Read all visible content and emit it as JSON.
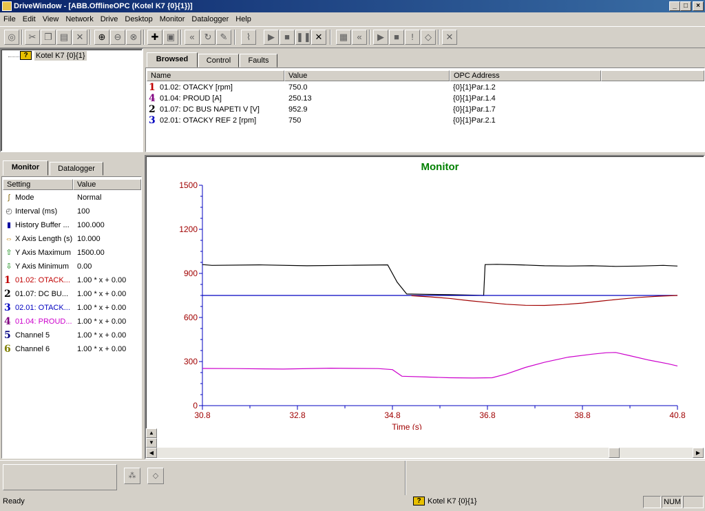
{
  "window": {
    "title": "DriveWindow - [ABB.OfflineOPC (Kotel K7 {0}{1})]",
    "min_label": "_",
    "max_label": "□",
    "close_label": "×"
  },
  "menu": [
    "File",
    "Edit",
    "View",
    "Network",
    "Drive",
    "Desktop",
    "Monitor",
    "Datalogger",
    "Help"
  ],
  "tree": {
    "root_label": "Kotel K7 {0}{1}"
  },
  "top_tabs": [
    "Browsed",
    "Control",
    "Faults"
  ],
  "browsed": {
    "columns": [
      "Name",
      "Value",
      "OPC Address"
    ],
    "rows": [
      {
        "num": "1",
        "color": "#c00000",
        "name": "01.02: OTACKY [rpm]",
        "value": "750.0",
        "opc": "{0}{1}Par.1.2"
      },
      {
        "num": "4",
        "color": "#800080",
        "name": "01.04: PROUD [A]",
        "value": "250.13",
        "opc": "{0}{1}Par.1.4"
      },
      {
        "num": "2",
        "color": "#000000",
        "name": "01.07: DC BUS NAPETI V [V]",
        "value": "952.9",
        "opc": "{0}{1}Par.1.7"
      },
      {
        "num": "3",
        "color": "#0000c0",
        "name": "02.01: OTACKY REF 2 [rpm]",
        "value": "750",
        "opc": "{0}{1}Par.2.1"
      }
    ]
  },
  "left_tabs": [
    "Monitor",
    "Datalogger"
  ],
  "settings": {
    "columns": [
      "Setting",
      "Value"
    ],
    "rows": [
      {
        "icon": "mode-icon",
        "label": "Mode",
        "value": "Normal",
        "color": "#000000"
      },
      {
        "icon": "clock-icon",
        "label": "Interval (ms)",
        "value": "100",
        "color": "#000000"
      },
      {
        "icon": "book-icon",
        "label": "History Buffer ...",
        "value": "100.000",
        "color": "#000000"
      },
      {
        "icon": "arrows-icon",
        "label": "X Axis Length (s)",
        "value": "10.000",
        "color": "#000000"
      },
      {
        "icon": "up-arrow-icon",
        "label": "Y Axis Maximum",
        "value": "1500.00",
        "color": "#000000"
      },
      {
        "icon": "down-arrow-icon",
        "label": "Y Axis Minimum",
        "value": "0.00",
        "color": "#000000"
      },
      {
        "num": "1",
        "numcolor": "#c00000",
        "label": "01.02: OTACK...",
        "value": "1.00 * x + 0.00",
        "color": "#c00000"
      },
      {
        "num": "2",
        "numcolor": "#000000",
        "label": "01.07: DC BU...",
        "value": "1.00 * x + 0.00",
        "color": "#000000"
      },
      {
        "num": "3",
        "numcolor": "#0000c0",
        "label": "02.01: OTACK...",
        "value": "1.00 * x + 0.00",
        "color": "#0000c0"
      },
      {
        "num": "4",
        "numcolor": "#800080",
        "label": "01.04: PROUD...",
        "value": "1.00 * x + 0.00",
        "color": "#cc00cc"
      },
      {
        "num": "5",
        "numcolor": "#000080",
        "label": "Channel 5",
        "value": "1.00 * x + 0.00",
        "color": "#000000"
      },
      {
        "num": "6",
        "numcolor": "#808000",
        "label": "Channel 6",
        "value": "1.00 * x + 0.00",
        "color": "#000000"
      }
    ]
  },
  "chart_data": {
    "type": "line",
    "title": "Monitor",
    "xlabel": "Time (s)",
    "ylabel": "",
    "xlim": [
      30.8,
      40.8
    ],
    "ylim": [
      0,
      1500
    ],
    "xticks": [
      "30.8",
      "32.8",
      "34.8",
      "36.8",
      "38.8",
      "40.8"
    ],
    "yticks": [
      "0",
      "300",
      "600",
      "900",
      "1200",
      "1500"
    ],
    "series": [
      {
        "color": "#000000",
        "x": [
          30.8,
          31.0,
          32.0,
          33.0,
          34.0,
          34.7,
          34.9,
          35.1,
          35.5,
          36.0,
          36.5,
          36.72,
          36.75,
          37.0,
          37.5,
          38.0,
          38.5,
          39.0,
          39.5,
          40.0,
          40.5,
          40.8
        ],
        "y": [
          960,
          955,
          958,
          952,
          956,
          958,
          840,
          760,
          758,
          755,
          752,
          750,
          960,
          962,
          958,
          952,
          950,
          952,
          948,
          950,
          955,
          950
        ]
      },
      {
        "color": "#0000c0",
        "x": [
          30.8,
          40.8
        ],
        "y": [
          750,
          750
        ]
      },
      {
        "color": "#a00000",
        "x": [
          35.2,
          35.6,
          36.0,
          36.4,
          36.8,
          37.2,
          37.6,
          38.0,
          38.4,
          38.8,
          39.2,
          39.6,
          40.0,
          40.4,
          40.8
        ],
        "y": [
          748,
          740,
          730,
          715,
          702,
          690,
          683,
          682,
          688,
          698,
          712,
          725,
          737,
          745,
          750
        ]
      },
      {
        "color": "#cc00cc",
        "x": [
          30.8,
          31.5,
          32.5,
          33.5,
          34.5,
          34.8,
          35.0,
          35.5,
          36.0,
          36.5,
          36.9,
          37.2,
          37.6,
          38.0,
          38.5,
          39.0,
          39.3,
          39.5,
          39.8,
          40.2,
          40.6,
          40.8
        ],
        "y": [
          253,
          252,
          249,
          255,
          252,
          245,
          200,
          195,
          190,
          188,
          190,
          215,
          260,
          295,
          330,
          350,
          360,
          362,
          340,
          310,
          285,
          270
        ]
      }
    ]
  },
  "bottom_buttons": {
    "b1": "",
    "b2": ""
  },
  "status": {
    "ready": "Ready",
    "device": "Kotel K7 {0}{1}",
    "num": "NUM"
  }
}
